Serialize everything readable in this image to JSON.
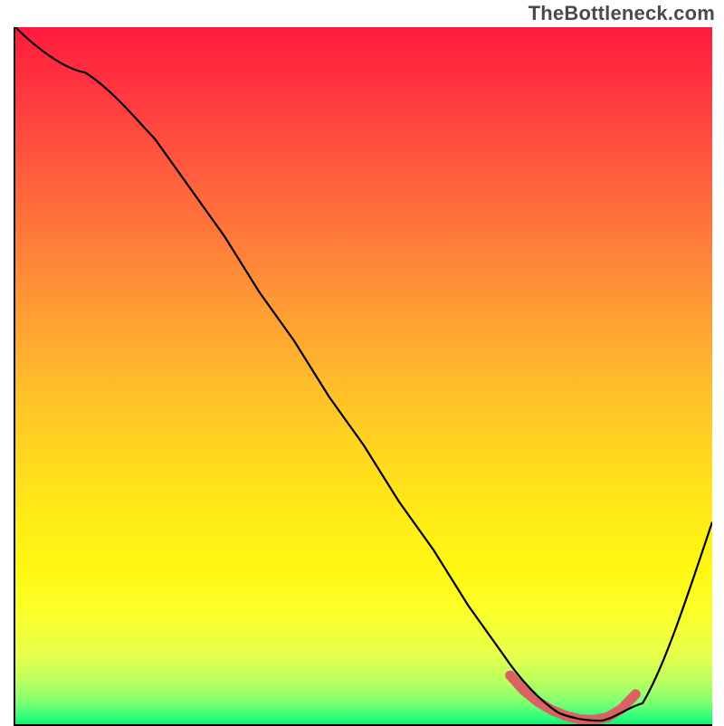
{
  "watermark": "TheBottleneck.com",
  "chart_data": {
    "type": "line",
    "title": "",
    "xlabel": "",
    "ylabel": "",
    "xlim": [
      0,
      100
    ],
    "ylim": [
      0,
      100
    ],
    "grid": false,
    "legend": false,
    "series": [
      {
        "name": "curve",
        "color": "#000000",
        "x": [
          0,
          5,
          10,
          15,
          20,
          25,
          30,
          35,
          40,
          45,
          50,
          55,
          60,
          65,
          70,
          75,
          80,
          85,
          90,
          95,
          100
        ],
        "y": [
          100,
          97,
          94,
          90,
          84,
          77,
          70,
          62,
          55,
          47,
          40,
          32,
          25,
          17,
          10,
          4.5,
          1.5,
          0.5,
          3,
          13,
          29
        ]
      },
      {
        "name": "optimal_zone",
        "color": "#da6262",
        "x": [
          71,
          73,
          75,
          77,
          79,
          81,
          83,
          85,
          87,
          89
        ],
        "y": [
          7,
          4.8,
          3.2,
          2,
          1.2,
          0.7,
          0.6,
          1,
          2.2,
          4.3
        ]
      }
    ]
  }
}
